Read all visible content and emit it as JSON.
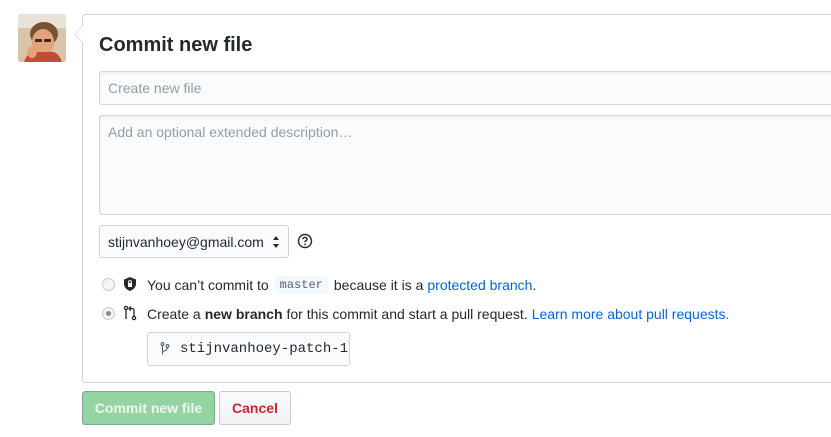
{
  "avatar": {
    "alt": "stijnvanhoey",
    "icon": "user-avatar"
  },
  "commit_form": {
    "title": "Commit new file",
    "summary_placeholder": "Create new file",
    "description_placeholder": "Add an optional extended description…",
    "email_value": "stijnvanhoey@gmail.com",
    "options": {
      "direct": {
        "prefix": "You can’t commit to",
        "branch": "master",
        "middle": "because it is a",
        "link": "protected branch",
        "suffix": ".",
        "checked": false,
        "icon": "shield-lock-icon"
      },
      "new_branch": {
        "prefix": "Create a",
        "strong": "new branch",
        "middle": "for this commit and start a pull request.",
        "link": "Learn more about pull requests.",
        "checked": true,
        "icon": "pull-request-icon"
      }
    },
    "branch_name": "stijnvanhoey-patch-1"
  },
  "buttons": {
    "commit_label": "Commit new file",
    "cancel_label": "Cancel"
  },
  "colors": {
    "commit_button": "#94d3a2",
    "cancel_text": "#cb2431",
    "link": "#0366d6"
  }
}
